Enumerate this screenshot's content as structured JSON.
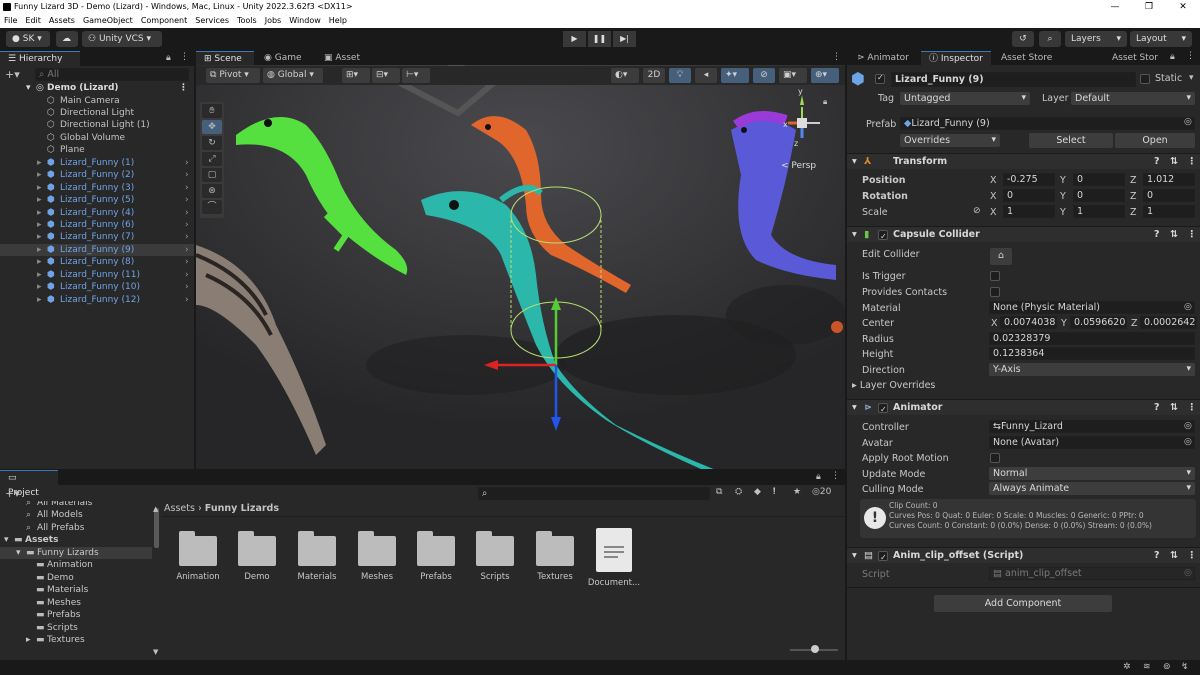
{
  "window": {
    "title": "Funny Lizard 3D - Demo (Lizard) - Windows, Mac, Linux - Unity 2022.3.62f3 <DX11>",
    "controls": [
      "—",
      "❐",
      "✕"
    ]
  },
  "menu": [
    "File",
    "Edit",
    "Assets",
    "GameObject",
    "Component",
    "Services",
    "Tools",
    "Jobs",
    "Window",
    "Help"
  ],
  "toolbar": {
    "account": "SK",
    "vcs": "Unity VCS",
    "layers": "Layers",
    "layout": "Layout"
  },
  "hierarchy": {
    "tab": "Hierarchy",
    "search_placeholder": "All",
    "scene": "Demo (Lizard)",
    "items": [
      {
        "label": "Main Camera",
        "prefab": false
      },
      {
        "label": "Directional Light",
        "prefab": false
      },
      {
        "label": "Directional Light (1)",
        "prefab": false
      },
      {
        "label": "Global Volume",
        "prefab": false
      },
      {
        "label": "Plane",
        "prefab": false
      },
      {
        "label": "Lizard_Funny (1)",
        "prefab": true
      },
      {
        "label": "Lizard_Funny (2)",
        "prefab": true
      },
      {
        "label": "Lizard_Funny (3)",
        "prefab": true
      },
      {
        "label": "Lizard_Funny (5)",
        "prefab": true
      },
      {
        "label": "Lizard_Funny (4)",
        "prefab": true
      },
      {
        "label": "Lizard_Funny (6)",
        "prefab": true
      },
      {
        "label": "Lizard_Funny (7)",
        "prefab": true
      },
      {
        "label": "Lizard_Funny (9)",
        "prefab": true,
        "selected": true
      },
      {
        "label": "Lizard_Funny (8)",
        "prefab": true
      },
      {
        "label": "Lizard_Funny (11)",
        "prefab": true
      },
      {
        "label": "Lizard_Funny (10)",
        "prefab": true
      },
      {
        "label": "Lizard_Funny (12)",
        "prefab": true
      }
    ]
  },
  "scene_tabs": [
    "Scene",
    "Game",
    "Asset Store"
  ],
  "scene_toolbar": {
    "pivot": "Pivot",
    "global": "Global",
    "mode2d": "2D",
    "persp": "< Persp",
    "gizmo_y": "y",
    "gizmo_x": "x",
    "gizmo_z": "z"
  },
  "project": {
    "tab": "Project",
    "search_count": "20",
    "breadcrumb": [
      "Assets",
      "Funny Lizards"
    ],
    "tree": [
      {
        "label": "All Materials",
        "indent": 1
      },
      {
        "label": "All Models",
        "indent": 1
      },
      {
        "label": "All Prefabs",
        "indent": 1
      },
      {
        "label": "Assets",
        "indent": 0,
        "bold": true
      },
      {
        "label": "Funny Lizards",
        "indent": 1,
        "selected": true
      },
      {
        "label": "Animation",
        "indent": 2
      },
      {
        "label": "Demo",
        "indent": 2
      },
      {
        "label": "Materials",
        "indent": 2
      },
      {
        "label": "Meshes",
        "indent": 2
      },
      {
        "label": "Prefabs",
        "indent": 2
      },
      {
        "label": "Scripts",
        "indent": 2
      },
      {
        "label": "Textures",
        "indent": 2
      }
    ],
    "folders": [
      "Animation",
      "Demo",
      "Materials",
      "Meshes",
      "Prefabs",
      "Scripts",
      "Textures"
    ],
    "document": "Document..."
  },
  "inspector": {
    "tabs": [
      "Animator",
      "Inspector",
      "Asset Store Uploader",
      "Asset Stor"
    ],
    "object_name": "Lizard_Funny (9)",
    "static_label": "Static",
    "tag_label": "Tag",
    "tag_value": "Untagged",
    "layer_label": "Layer",
    "layer_value": "Default",
    "prefab_label": "Prefab",
    "prefab_value": "Lizard_Funny (9)",
    "overrides": "Overrides",
    "select": "Select",
    "open": "Open",
    "transform": {
      "title": "Transform",
      "position": {
        "label": "Position",
        "x": "-0.275",
        "y": "0",
        "z": "1.012"
      },
      "rotation": {
        "label": "Rotation",
        "x": "0",
        "y": "0",
        "z": "0"
      },
      "scale": {
        "label": "Scale",
        "x": "1",
        "y": "1",
        "z": "1"
      }
    },
    "capsule": {
      "title": "Capsule Collider",
      "edit_collider": "Edit Collider",
      "is_trigger": "Is Trigger",
      "provides_contacts": "Provides Contacts",
      "material_label": "Material",
      "material_value": "None (Physic Material)",
      "center_label": "Center",
      "center_x": "0.0074038",
      "center_y": "0.0596620",
      "center_z": "0.0002642",
      "radius_label": "Radius",
      "radius_value": "0.02328379",
      "height_label": "Height",
      "height_value": "0.1238364",
      "direction_label": "Direction",
      "direction_value": "Y-Axis",
      "layer_overrides": "Layer Overrides"
    },
    "animator": {
      "title": "Animator",
      "controller_label": "Controller",
      "controller_value": "Funny_Lizard",
      "avatar_label": "Avatar",
      "avatar_value": "None (Avatar)",
      "root_motion_label": "Apply Root Motion",
      "update_label": "Update Mode",
      "update_value": "Normal",
      "culling_label": "Culling Mode",
      "culling_value": "Always Animate",
      "info": [
        "Clip Count: 0",
        "Curves Pos: 0 Quat: 0 Euler: 0 Scale: 0 Muscles: 0 Generic: 0 PPtr: 0",
        "Curves Count: 0 Constant: 0 (0.0%) Dense: 0 (0.0%) Stream: 0 (0.0%)"
      ]
    },
    "script": {
      "title": "Anim_clip_offset (Script)",
      "label": "Script",
      "value": "anim_clip_offset"
    },
    "add_component": "Add Component"
  }
}
